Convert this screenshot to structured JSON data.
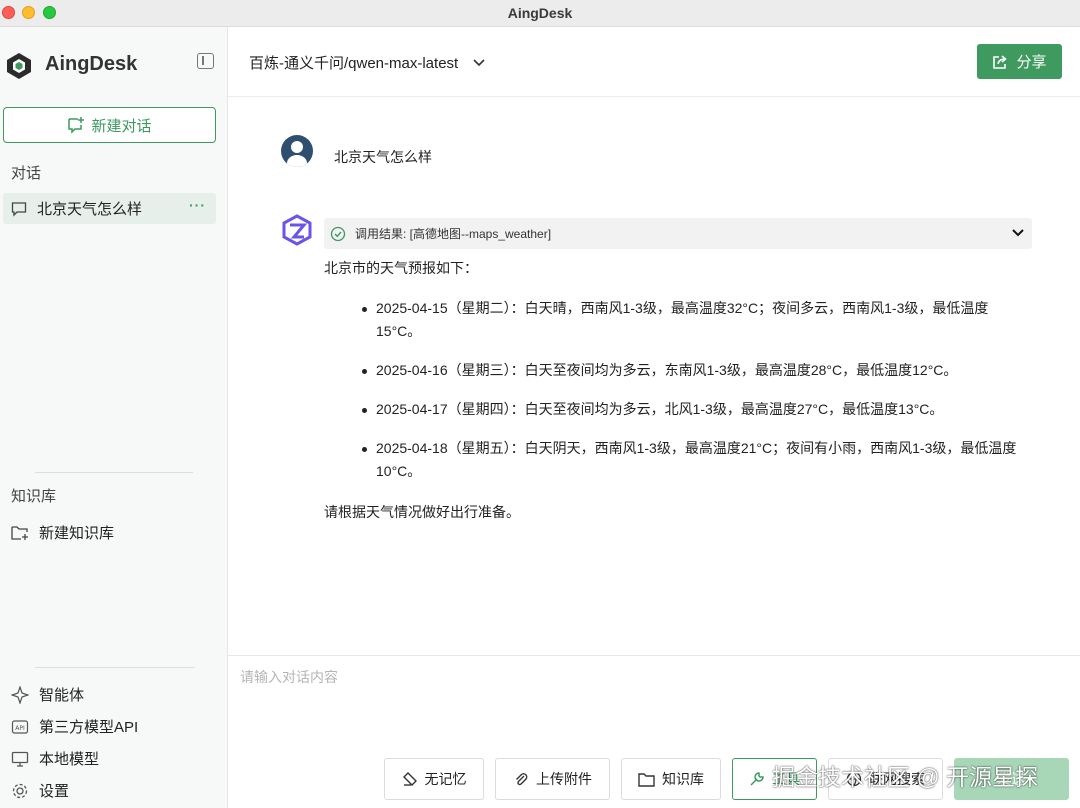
{
  "window": {
    "title": "AingDesk"
  },
  "sidebar": {
    "brand": "AingDesk",
    "new_chat_label": "新建对话",
    "conversations_label": "对话",
    "conversations": [
      {
        "title": "北京天气怎么样",
        "more": "···"
      }
    ],
    "knowledge_label": "知识库",
    "new_knowledge_label": "新建知识库",
    "bottom_items": [
      {
        "label": "智能体",
        "icon": "sparkle-icon"
      },
      {
        "label": "第三方模型API",
        "icon": "api-icon"
      },
      {
        "label": "本地模型",
        "icon": "monitor-icon"
      },
      {
        "label": "设置",
        "icon": "gear-icon"
      }
    ]
  },
  "header": {
    "model": "百炼-通义千问/qwen-max-latest",
    "share_label": "分享"
  },
  "chat": {
    "user_message": "北京天气怎么样",
    "tool_result": "调用结果: [高德地图--maps_weather]",
    "answer": {
      "intro": "北京市的天气预报如下：",
      "items": [
        "2025-04-15（星期二）：白天晴，西南风1-3级，最高温度32°C；夜间多云，西南风1-3级，最低温度15°C。",
        "2025-04-16（星期三）：白天至夜间均为多云，东南风1-3级，最高温度28°C，最低温度12°C。",
        "2025-04-17（星期四）：白天至夜间均为多云，北风1-3级，最高温度27°C，最低温度13°C。",
        "2025-04-18（星期五）：白天阴天，西南风1-3级，最高温度21°C；夜间有小雨，西南风1-3级，最低温度10°C。"
      ],
      "outro": "请根据天气情况做好出行准备。"
    }
  },
  "input": {
    "placeholder": "请输入对话内容",
    "buttons": {
      "no_memory": "无记忆",
      "upload": "上传附件",
      "knowledge": "知识库",
      "tools": "工具",
      "web_search": "联网搜索",
      "send": "发送"
    }
  },
  "watermark": "掘金技术社区 @ 开源星探",
  "colors": {
    "accent": "#3c9a5f",
    "share_bg": "#3f9a5f",
    "avatar": "#2f4f71",
    "bot": "#6b55e8"
  }
}
